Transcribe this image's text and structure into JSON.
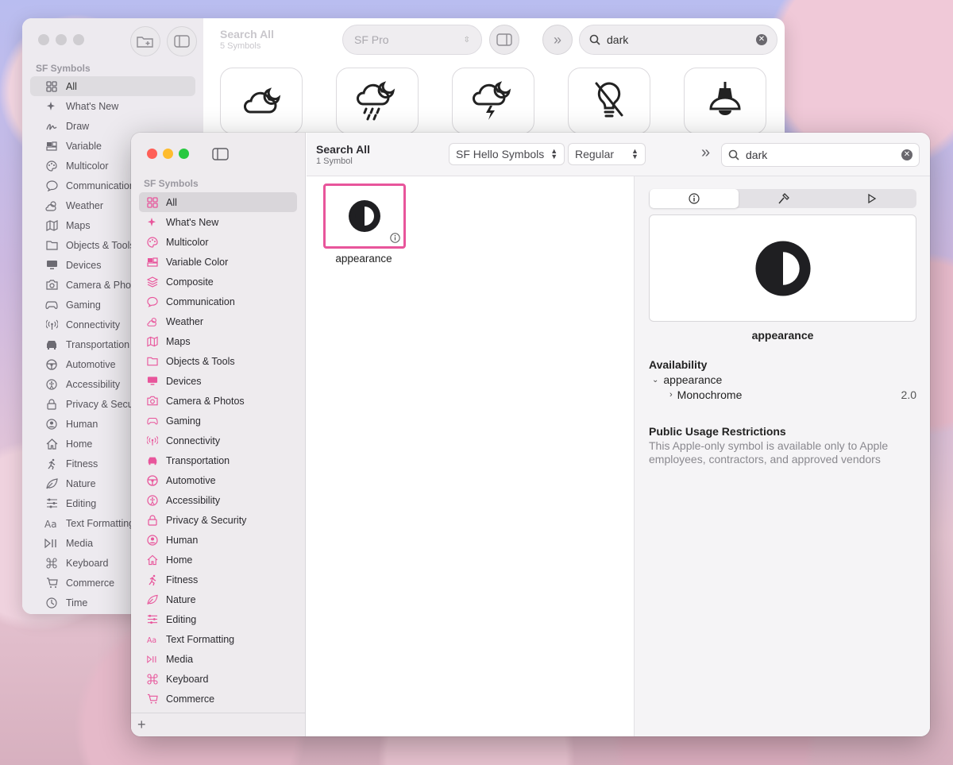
{
  "back_window": {
    "sidebar": {
      "section_title": "SF Symbols",
      "items": [
        {
          "label": "All",
          "icon": "grid-icon",
          "selected": true
        },
        {
          "label": "What's New",
          "icon": "sparkles-icon"
        },
        {
          "label": "Draw",
          "icon": "scribble-icon"
        },
        {
          "label": "Variable",
          "icon": "variable-icon"
        },
        {
          "label": "Multicolor",
          "icon": "paintpalette-icon"
        },
        {
          "label": "Communication",
          "icon": "bubble-icon"
        },
        {
          "label": "Weather",
          "icon": "cloud-sun-icon"
        },
        {
          "label": "Maps",
          "icon": "map-icon"
        },
        {
          "label": "Objects & Tools",
          "icon": "folder-icon"
        },
        {
          "label": "Devices",
          "icon": "display-icon"
        },
        {
          "label": "Camera & Photos",
          "icon": "camera-icon"
        },
        {
          "label": "Gaming",
          "icon": "gamecontroller-icon"
        },
        {
          "label": "Connectivity",
          "icon": "antenna-icon"
        },
        {
          "label": "Transportation",
          "icon": "car-icon"
        },
        {
          "label": "Automotive",
          "icon": "steeringwheel-icon"
        },
        {
          "label": "Accessibility",
          "icon": "accessibility-icon"
        },
        {
          "label": "Privacy & Security",
          "icon": "lock-icon"
        },
        {
          "label": "Human",
          "icon": "person-icon"
        },
        {
          "label": "Home",
          "icon": "house-icon"
        },
        {
          "label": "Fitness",
          "icon": "figure-run-icon"
        },
        {
          "label": "Nature",
          "icon": "leaf-icon"
        },
        {
          "label": "Editing",
          "icon": "sliders-icon"
        },
        {
          "label": "Text Formatting",
          "icon": "textformat-icon"
        },
        {
          "label": "Media",
          "icon": "playpause-icon"
        },
        {
          "label": "Keyboard",
          "icon": "command-icon"
        },
        {
          "label": "Commerce",
          "icon": "cart-icon"
        },
        {
          "label": "Time",
          "icon": "clock-icon"
        }
      ]
    },
    "header": {
      "title": "Search All",
      "subtitle": "5 Symbols"
    },
    "font_select": "SF Pro",
    "search": {
      "value": "dark",
      "placeholder": "Search"
    },
    "results": [
      "cloud-moon-icon",
      "cloud-moon-rain-icon",
      "cloud-moon-bolt-icon",
      "lightbulb-slash-icon",
      "lamp-ceiling-icon"
    ]
  },
  "front_window": {
    "sidebar": {
      "section_title": "SF Symbols",
      "items": [
        {
          "label": "All",
          "icon": "grid-icon",
          "selected": true
        },
        {
          "label": "What's New",
          "icon": "sparkles-icon"
        },
        {
          "label": "Multicolor",
          "icon": "paintpalette-icon"
        },
        {
          "label": "Variable Color",
          "icon": "variable-icon"
        },
        {
          "label": "Composite",
          "icon": "layers-icon"
        },
        {
          "label": "Communication",
          "icon": "bubble-icon"
        },
        {
          "label": "Weather",
          "icon": "cloud-sun-icon"
        },
        {
          "label": "Maps",
          "icon": "map-icon"
        },
        {
          "label": "Objects & Tools",
          "icon": "folder-icon"
        },
        {
          "label": "Devices",
          "icon": "display-icon"
        },
        {
          "label": "Camera & Photos",
          "icon": "camera-icon"
        },
        {
          "label": "Gaming",
          "icon": "gamecontroller-icon"
        },
        {
          "label": "Connectivity",
          "icon": "antenna-icon"
        },
        {
          "label": "Transportation",
          "icon": "car-icon"
        },
        {
          "label": "Automotive",
          "icon": "steeringwheel-icon"
        },
        {
          "label": "Accessibility",
          "icon": "accessibility-icon"
        },
        {
          "label": "Privacy & Security",
          "icon": "lock-icon"
        },
        {
          "label": "Human",
          "icon": "person-icon"
        },
        {
          "label": "Home",
          "icon": "house-icon"
        },
        {
          "label": "Fitness",
          "icon": "figure-run-icon"
        },
        {
          "label": "Nature",
          "icon": "leaf-icon"
        },
        {
          "label": "Editing",
          "icon": "sliders-icon"
        },
        {
          "label": "Text Formatting",
          "icon": "textformat-icon"
        },
        {
          "label": "Media",
          "icon": "playpause-icon"
        },
        {
          "label": "Keyboard",
          "icon": "command-icon"
        },
        {
          "label": "Commerce",
          "icon": "cart-icon"
        }
      ],
      "accent": "#e8559b"
    },
    "header": {
      "title": "Search All",
      "subtitle": "1 Symbol"
    },
    "font_select": "SF Hello Symbols",
    "weight_select": "Regular",
    "search": {
      "value": "dark",
      "placeholder": "Search"
    },
    "result": {
      "name": "appearance",
      "icon": "appearance-icon"
    },
    "inspector": {
      "tabs": [
        "info-icon",
        "hammer-icon",
        "play-icon"
      ],
      "symbol_name": "appearance",
      "availability_title": "Availability",
      "availability_item": "appearance",
      "availability_sub": "Monochrome",
      "availability_version": "2.0",
      "restrictions_title": "Public Usage Restrictions",
      "restrictions_text": "This Apple-only symbol is available only to Apple employees, contractors, and approved vendors"
    },
    "colors": {
      "close": "#ff5f57",
      "minimize": "#febc2e",
      "zoom": "#28c840",
      "selection_border": "#e8559b"
    }
  }
}
